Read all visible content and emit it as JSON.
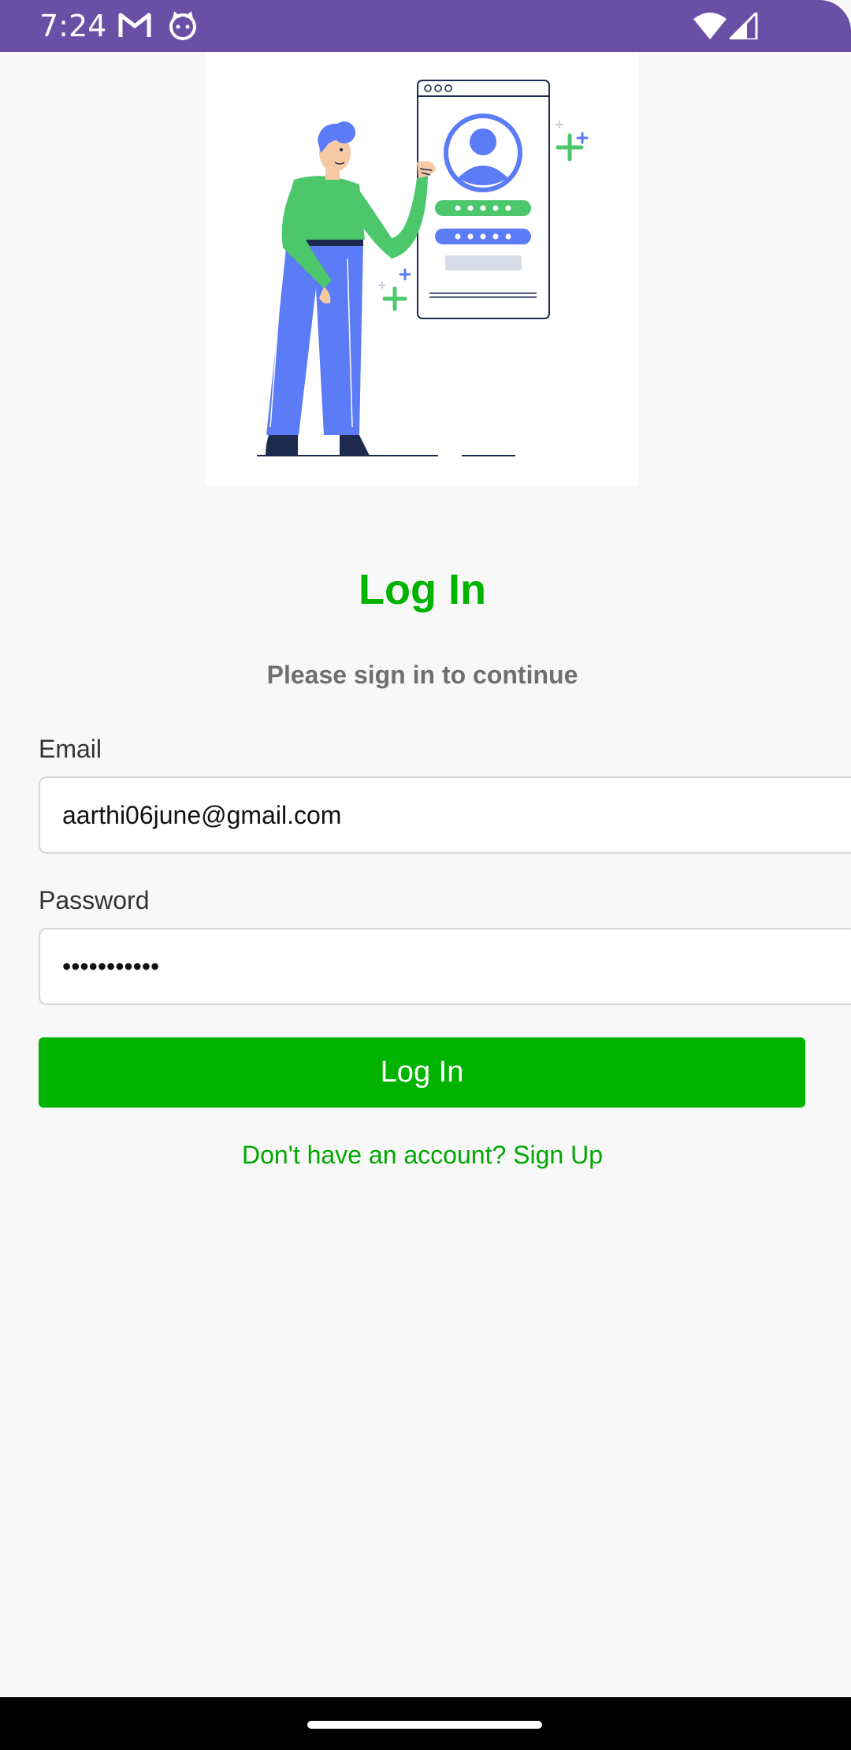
{
  "status_bar": {
    "time": "7:24",
    "icons": [
      "gmail-icon",
      "cat-face-icon",
      "wifi-icon",
      "cell-signal-icon"
    ]
  },
  "illustration": {
    "icon": "person-login-illustration"
  },
  "login": {
    "title": "Log In",
    "subtitle": "Please sign in to continue",
    "email_label": "Email",
    "email_value": "aarthi06june@gmail.com",
    "password_label": "Password",
    "password_value": "•••••••••••",
    "button_label": "Log In",
    "signup_text": "Don't have an account? Sign Up"
  },
  "colors": {
    "accent": "#00b300",
    "status_bar": "#6a4fa6",
    "illustration_green": "#4cc76b",
    "illustration_blue": "#5b7bf7"
  }
}
